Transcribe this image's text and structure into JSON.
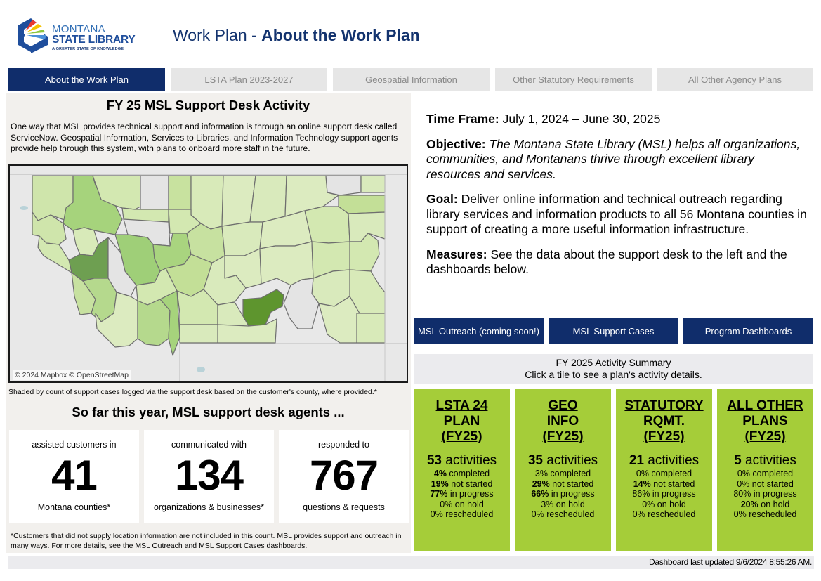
{
  "logo": {
    "line1": "MONTANA",
    "line2": "STATE LIBRARY",
    "tagline": "A GREATER STATE OF KNOWLEDGE"
  },
  "header": {
    "title_prefix": "Work Plan - ",
    "title_main": "About the Work Plan"
  },
  "tabs": [
    {
      "label": "About the Work Plan",
      "active": true
    },
    {
      "label": "LSTA Plan 2023-2027",
      "active": false
    },
    {
      "label": "Geospatial Information",
      "active": false
    },
    {
      "label": "Other Statutory Requirements",
      "active": false
    },
    {
      "label": "All Other Agency Plans",
      "active": false
    }
  ],
  "support_desk": {
    "title": "FY 25 MSL Support Desk Activity",
    "intro": "One way that MSL provides technical support and information is through an online support desk called ServiceNow. Geospatial Information, Services to Libraries, and Information Technology support agents provide help through this system, with plans to onboard more staff in the future.",
    "map_attribution": "© 2024 Mapbox © OpenStreetMap",
    "map_caption": "Shaded by count of support cases logged via the support desk based on the customer's county, where provided.*",
    "agents_title": "So far this year, MSL support desk agents ...",
    "kpis": [
      {
        "top": "assisted customers in",
        "value": "41",
        "bottom": "Montana counties*"
      },
      {
        "top": "communicated with",
        "value": "134",
        "bottom": "organizations & businesses*"
      },
      {
        "top": "responded to",
        "value": "767",
        "bottom": "questions & requests"
      }
    ],
    "footnote": "*Customers that did not supply location information are not included in this count. MSL provides support and outreach in many ways. For more details, see the MSL Outreach and MSL Support Cases dashboards."
  },
  "about": {
    "time_frame_label": "Time Frame:",
    "time_frame_value": " July 1, 2024 – June 30, 2025",
    "objective_label": "Objective:",
    "objective_value": " The Montana State Library (MSL) helps all organizations, communities, and Montanans thrive through excellent library resources and services.",
    "goal_label": "Goal:",
    "goal_value": " Deliver online information and technical outreach regarding library services and information products to all 56 Montana counties in support of creating a more useful information infrastructure.",
    "measures_label": "Measures:",
    "measures_value": " See the data about the support desk to the left and the dashboards below."
  },
  "nav_buttons": [
    {
      "label": "MSL Outreach (coming soon!)"
    },
    {
      "label": "MSL Support Cases"
    },
    {
      "label": "Program Dashboards"
    }
  ],
  "summary": {
    "title": "FY 2025 Activity Summary",
    "subtitle": "Click a tile to see a plan's activity details."
  },
  "tiles": [
    {
      "name_lines": [
        "LSTA 24",
        "PLAN",
        "(FY25)"
      ],
      "count": "53",
      "count_label": " activities",
      "stats": [
        {
          "pct": "4%",
          "label": " completed",
          "bold": true
        },
        {
          "pct": "19%",
          "label": " not started",
          "bold": true
        },
        {
          "pct": "77%",
          "label": " in progress",
          "bold": true
        },
        {
          "pct": "0%",
          "label": " on hold",
          "bold": false
        },
        {
          "pct": "0%",
          "label": " rescheduled",
          "bold": false
        }
      ]
    },
    {
      "name_lines": [
        "GEO",
        "INFO",
        "(FY25)"
      ],
      "count": "35",
      "count_label": " activities",
      "stats": [
        {
          "pct": "3%",
          "label": " completed",
          "bold": false
        },
        {
          "pct": "29%",
          "label": " not started",
          "bold": true
        },
        {
          "pct": "66%",
          "label": " in progress",
          "bold": true
        },
        {
          "pct": "3%",
          "label": " on hold",
          "bold": false
        },
        {
          "pct": "0%",
          "label": " rescheduled",
          "bold": false
        }
      ]
    },
    {
      "name_lines": [
        "STATUTORY",
        "RQMT.",
        "(FY25)"
      ],
      "count": "21",
      "count_label": " activities",
      "stats": [
        {
          "pct": "0%",
          "label": " completed",
          "bold": false
        },
        {
          "pct": "14%",
          "label": " not started",
          "bold": true
        },
        {
          "pct": "86%",
          "label": " in progress",
          "bold": false
        },
        {
          "pct": "0%",
          "label": " on hold",
          "bold": false
        },
        {
          "pct": "0%",
          "label": " rescheduled",
          "bold": false
        }
      ]
    },
    {
      "name_lines": [
        "ALL OTHER",
        "PLANS",
        "(FY25)"
      ],
      "count": "5",
      "count_label": " activities",
      "stats": [
        {
          "pct": "0%",
          "label": " completed",
          "bold": false
        },
        {
          "pct": "0%",
          "label": " not started",
          "bold": false
        },
        {
          "pct": "80%",
          "label": " in progress",
          "bold": false
        },
        {
          "pct": "20%",
          "label": " on hold",
          "bold": true
        },
        {
          "pct": "0%",
          "label": " rescheduled",
          "bold": false
        }
      ]
    }
  ],
  "colors": {
    "brand_navy": "#102d6b",
    "tile_green": "#a5cd39",
    "tab_inactive": "#e6e6e6",
    "panel_bg": "#f2f0ed"
  },
  "footer": {
    "last_updated": "Dashboard last updated 9/6/2024 8:55:26 AM."
  }
}
